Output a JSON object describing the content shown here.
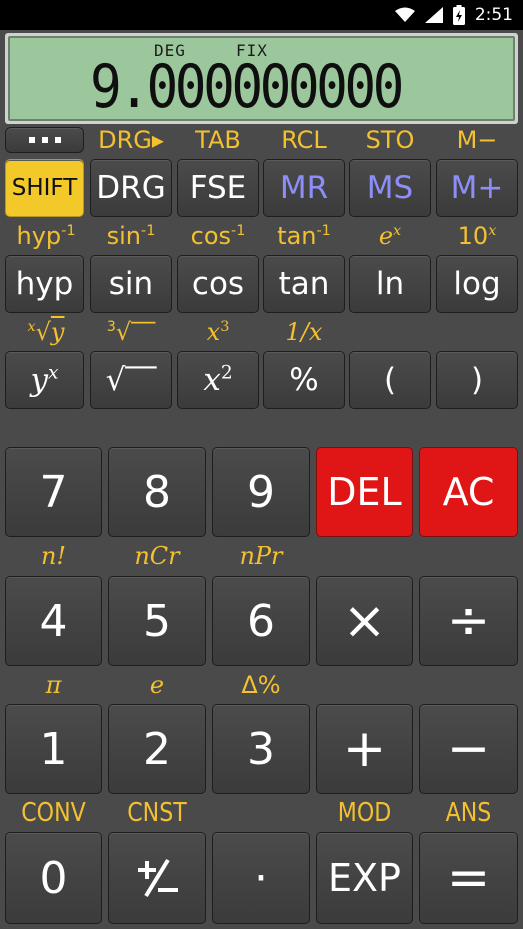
{
  "status_bar": {
    "time": "2:51",
    "icons": [
      "wifi-icon",
      "signal-icon",
      "battery-charging-icon"
    ]
  },
  "display": {
    "angle_mode": "DEG",
    "format_mode": "FIX",
    "value": "9.000000000"
  },
  "row1_labels": [
    "DRG▸",
    "TAB",
    "RCL",
    "STO",
    "M−"
  ],
  "row1_keys": [
    "SHIFT",
    "DRG",
    "FSE",
    "MR",
    "MS",
    "M+"
  ],
  "row2_labels": [
    "hyp-1",
    "sin-1",
    "cos-1",
    "tan-1",
    "ex",
    "10x"
  ],
  "row2_keys": [
    "hyp",
    "sin",
    "cos",
    "tan",
    "ln",
    "log"
  ],
  "row3_labels": [
    "x√y",
    "3√",
    "x3",
    "1/x"
  ],
  "row3_keys": [
    "yx",
    "√",
    "x2",
    "%",
    "(",
    ")"
  ],
  "row4_keys": [
    "7",
    "8",
    "9",
    "DEL",
    "AC"
  ],
  "row5_labels": [
    "n!",
    "nCr",
    "nPr"
  ],
  "row5_keys": [
    "4",
    "5",
    "6",
    "×",
    "÷"
  ],
  "row6_labels": [
    "π",
    "e",
    "Δ%"
  ],
  "row6_keys": [
    "1",
    "2",
    "3",
    "+",
    "−"
  ],
  "row7_labels": [
    "CONV",
    "CNST",
    "MOD",
    "ANS"
  ],
  "row7_keys": [
    "0",
    "+/−",
    "·",
    "EXP",
    "="
  ],
  "colors": {
    "shift_key": "#f3c92a",
    "shift_label": "#f3c030",
    "memory_key_text": "#8e8ef8",
    "red_key": "#e01515",
    "lcd": "#9cc79c"
  }
}
